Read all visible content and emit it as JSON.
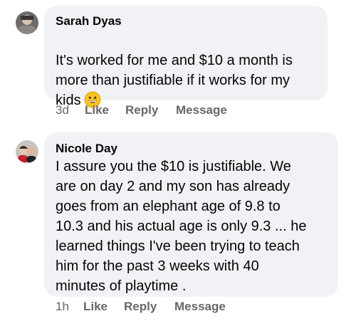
{
  "comments": [
    {
      "author": "Sarah Dyas",
      "text_main": "It's worked for me and $10 a month is\nmore than justifiable if it works for my\nkids",
      "emoji_icon": "grinning-face-emoji",
      "time": "3d",
      "like": "Like",
      "reply": "Reply",
      "message": "Message"
    },
    {
      "author": "Nicole Day",
      "text_main": "I assure you the $10 is justifiable. We\nare on day 2 and my son has already\ngoes from an elephant age of 9.8 to\n10.3 and his actual age is only 9.3 ... he\nlearned things I've been trying to teach\nhim for the past 3 weeks with 40\nminutes of playtime .",
      "time": "1h",
      "like": "Like",
      "reply": "Reply",
      "message": "Message"
    }
  ],
  "colors": {
    "bubble": "#f0f2f5",
    "text": "#050505",
    "meta": "#65676b"
  }
}
